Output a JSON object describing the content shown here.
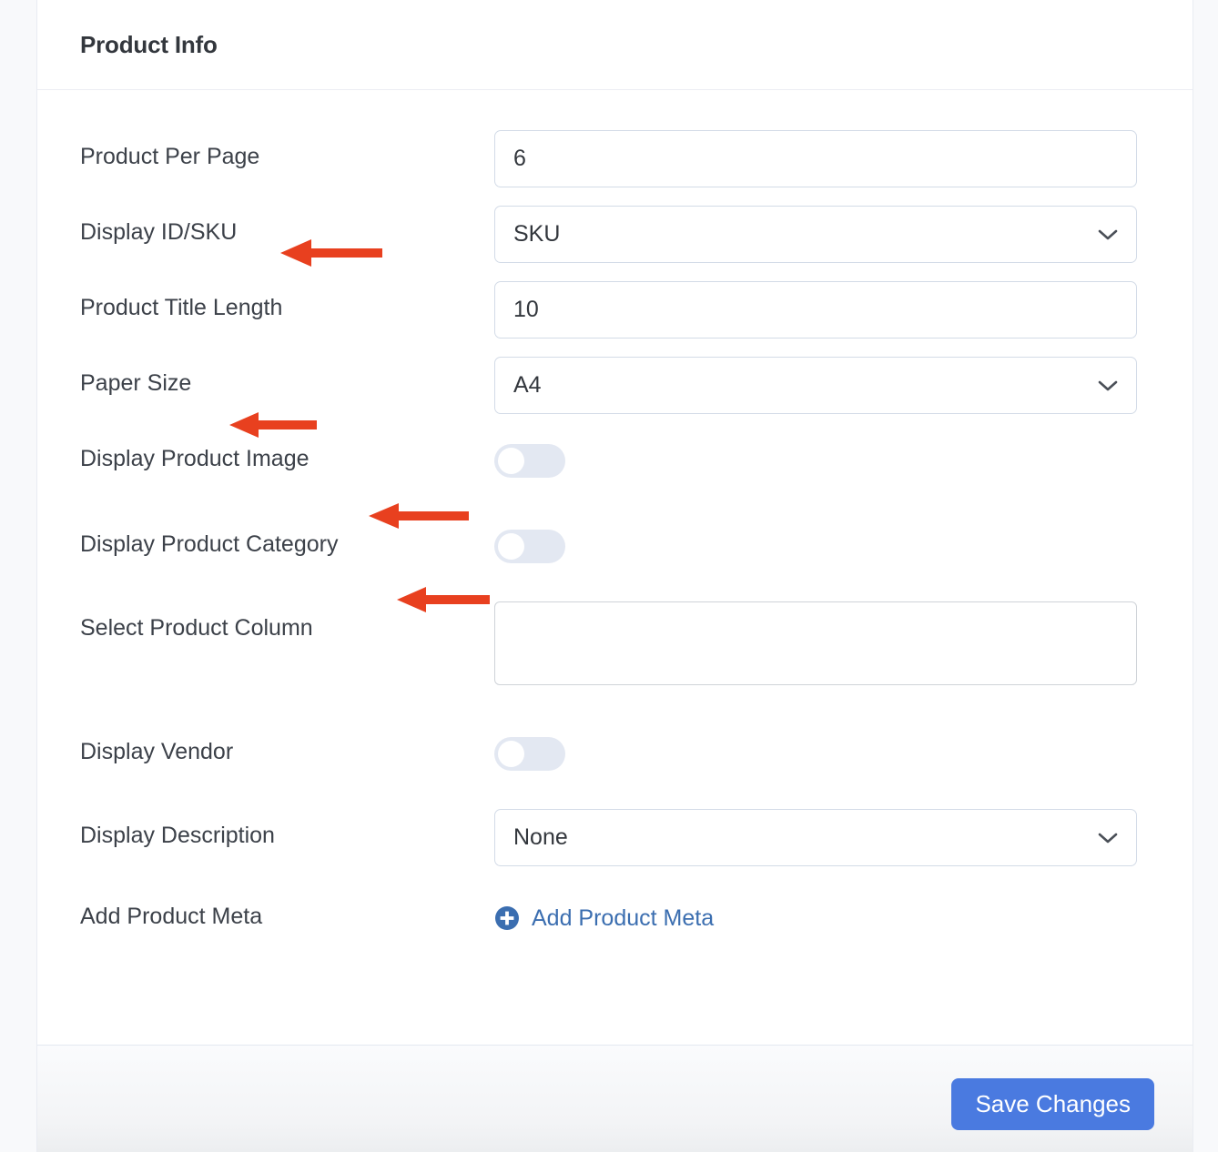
{
  "card": {
    "title": "Product Info"
  },
  "form": {
    "rows": [
      {
        "label": "Product Per Page",
        "type": "text",
        "value": "6",
        "annotated": false
      },
      {
        "label": "Display ID/SKU",
        "type": "select",
        "value": "SKU",
        "annotated": true
      },
      {
        "label": "Product Title Length",
        "type": "text",
        "value": "10",
        "annotated": false
      },
      {
        "label": "Paper Size",
        "type": "select",
        "value": "A4",
        "annotated": true
      },
      {
        "label": "Display Product Image",
        "type": "toggle",
        "value": "off",
        "annotated": true
      },
      {
        "label": "Display Product Category",
        "type": "toggle",
        "value": "off",
        "annotated": true
      },
      {
        "label": "Select Product Column",
        "type": "multiselect",
        "value": "",
        "annotated": false
      },
      {
        "label": "Display Vendor",
        "type": "toggle",
        "value": "off",
        "annotated": false
      },
      {
        "label": "Display Description",
        "type": "select",
        "value": "None",
        "annotated": false
      },
      {
        "label": "Add Product Meta",
        "type": "link",
        "value": "Add Product Meta",
        "annotated": false
      }
    ]
  },
  "footer": {
    "save_label": "Save Changes"
  },
  "colors": {
    "accent_blue": "#4a7ae0",
    "link_blue": "#3b6eb0",
    "annotation_red": "#e8401f",
    "toggle_track": "#e3e8f2",
    "field_border": "#d3dbe7"
  },
  "annotations": {
    "arrow_count": 4,
    "arrows": [
      {
        "target": "Display ID/SKU",
        "direction": "left"
      },
      {
        "target": "Paper Size",
        "direction": "left"
      },
      {
        "target": "Display Product Image",
        "direction": "left"
      },
      {
        "target": "Display Product Category",
        "direction": "left"
      }
    ]
  }
}
